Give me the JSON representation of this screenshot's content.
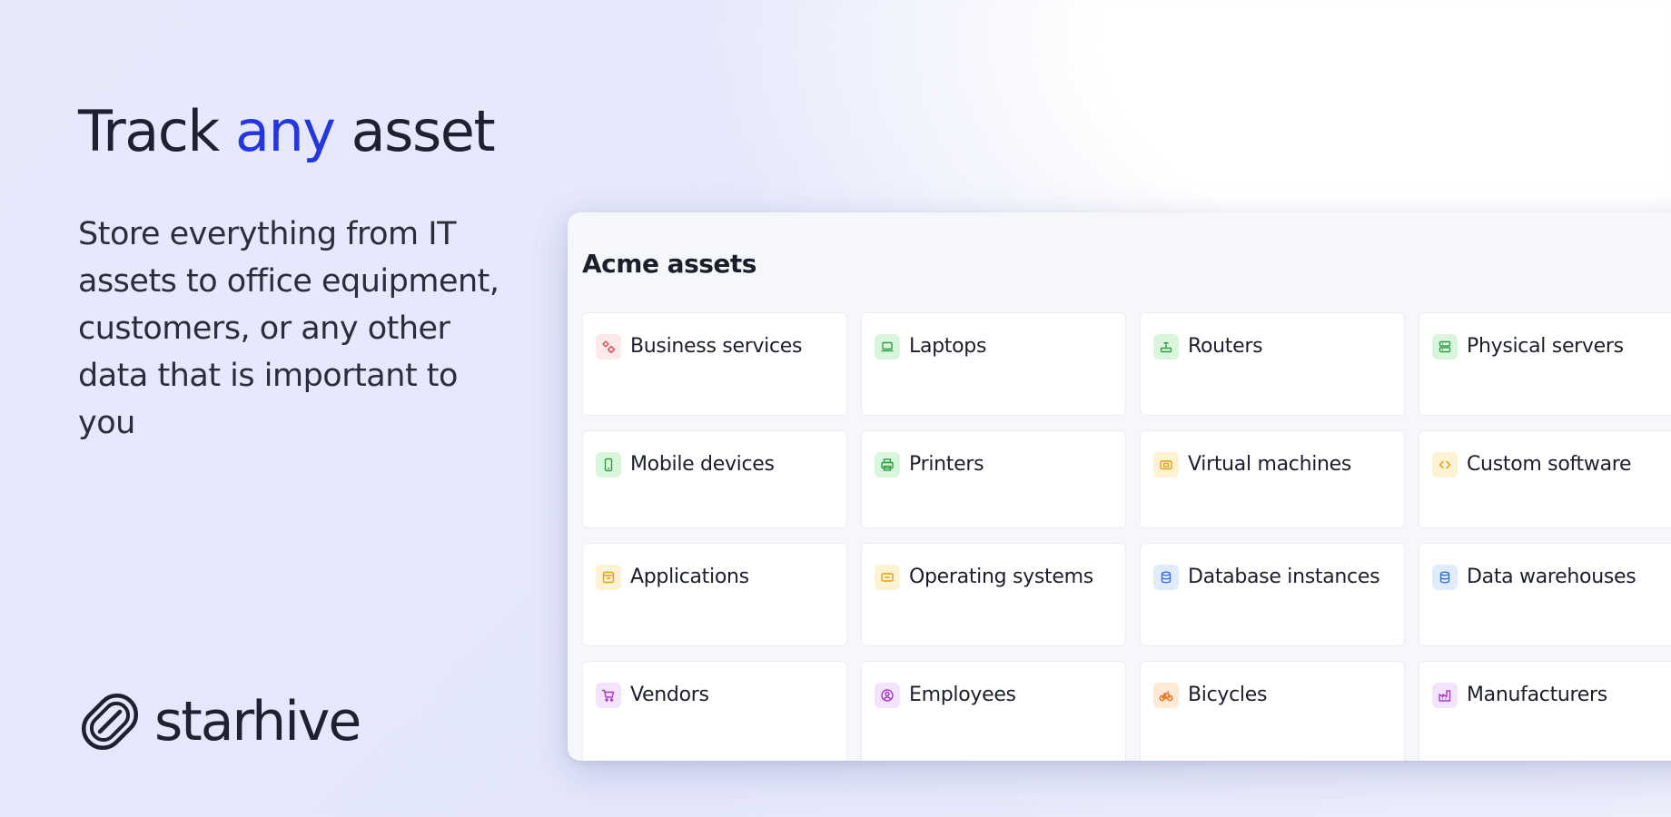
{
  "hero": {
    "title_pre": "Track ",
    "title_accent": "any",
    "title_post": " asset",
    "subtitle": "Store everything from IT assets to office equipment, customers, or any other data that is important to you"
  },
  "brand": {
    "name": "starhive",
    "logo_icon": "starhive-logo-icon"
  },
  "panel": {
    "title": "Acme assets",
    "cards": [
      {
        "label": "Business services",
        "icon": "gears-icon",
        "color": "#e0454f"
      },
      {
        "label": "Laptops",
        "icon": "laptop-icon",
        "color": "#2f9d46"
      },
      {
        "label": "Routers",
        "icon": "router-icon",
        "color": "#2f9d46"
      },
      {
        "label": "Physical servers",
        "icon": "server-icon",
        "color": "#2f9d46"
      },
      {
        "label": "Mobile devices",
        "icon": "mobile-icon",
        "color": "#2f9d46"
      },
      {
        "label": "Printers",
        "icon": "printer-icon",
        "color": "#2f9d46"
      },
      {
        "label": "Virtual machines",
        "icon": "virtual-machine-icon",
        "color": "#e2a20e"
      },
      {
        "label": "Custom software",
        "icon": "code-icon",
        "color": "#e2a20e"
      },
      {
        "label": "Applications",
        "icon": "application-icon",
        "color": "#e2a20e"
      },
      {
        "label": "Operating systems",
        "icon": "operating-system-icon",
        "color": "#e2a20e"
      },
      {
        "label": "Database instances",
        "icon": "database-icon",
        "color": "#3470d8"
      },
      {
        "label": "Data warehouses",
        "icon": "database-icon",
        "color": "#3470d8"
      },
      {
        "label": "Vendors",
        "icon": "cart-icon",
        "color": "#a436cc"
      },
      {
        "label": "Employees",
        "icon": "user-circle-icon",
        "color": "#a436cc"
      },
      {
        "label": "Bicycles",
        "icon": "bicycle-icon",
        "color": "#ea6d12"
      },
      {
        "label": "Manufacturers",
        "icon": "factory-icon",
        "color": "#a436cc"
      }
    ]
  }
}
